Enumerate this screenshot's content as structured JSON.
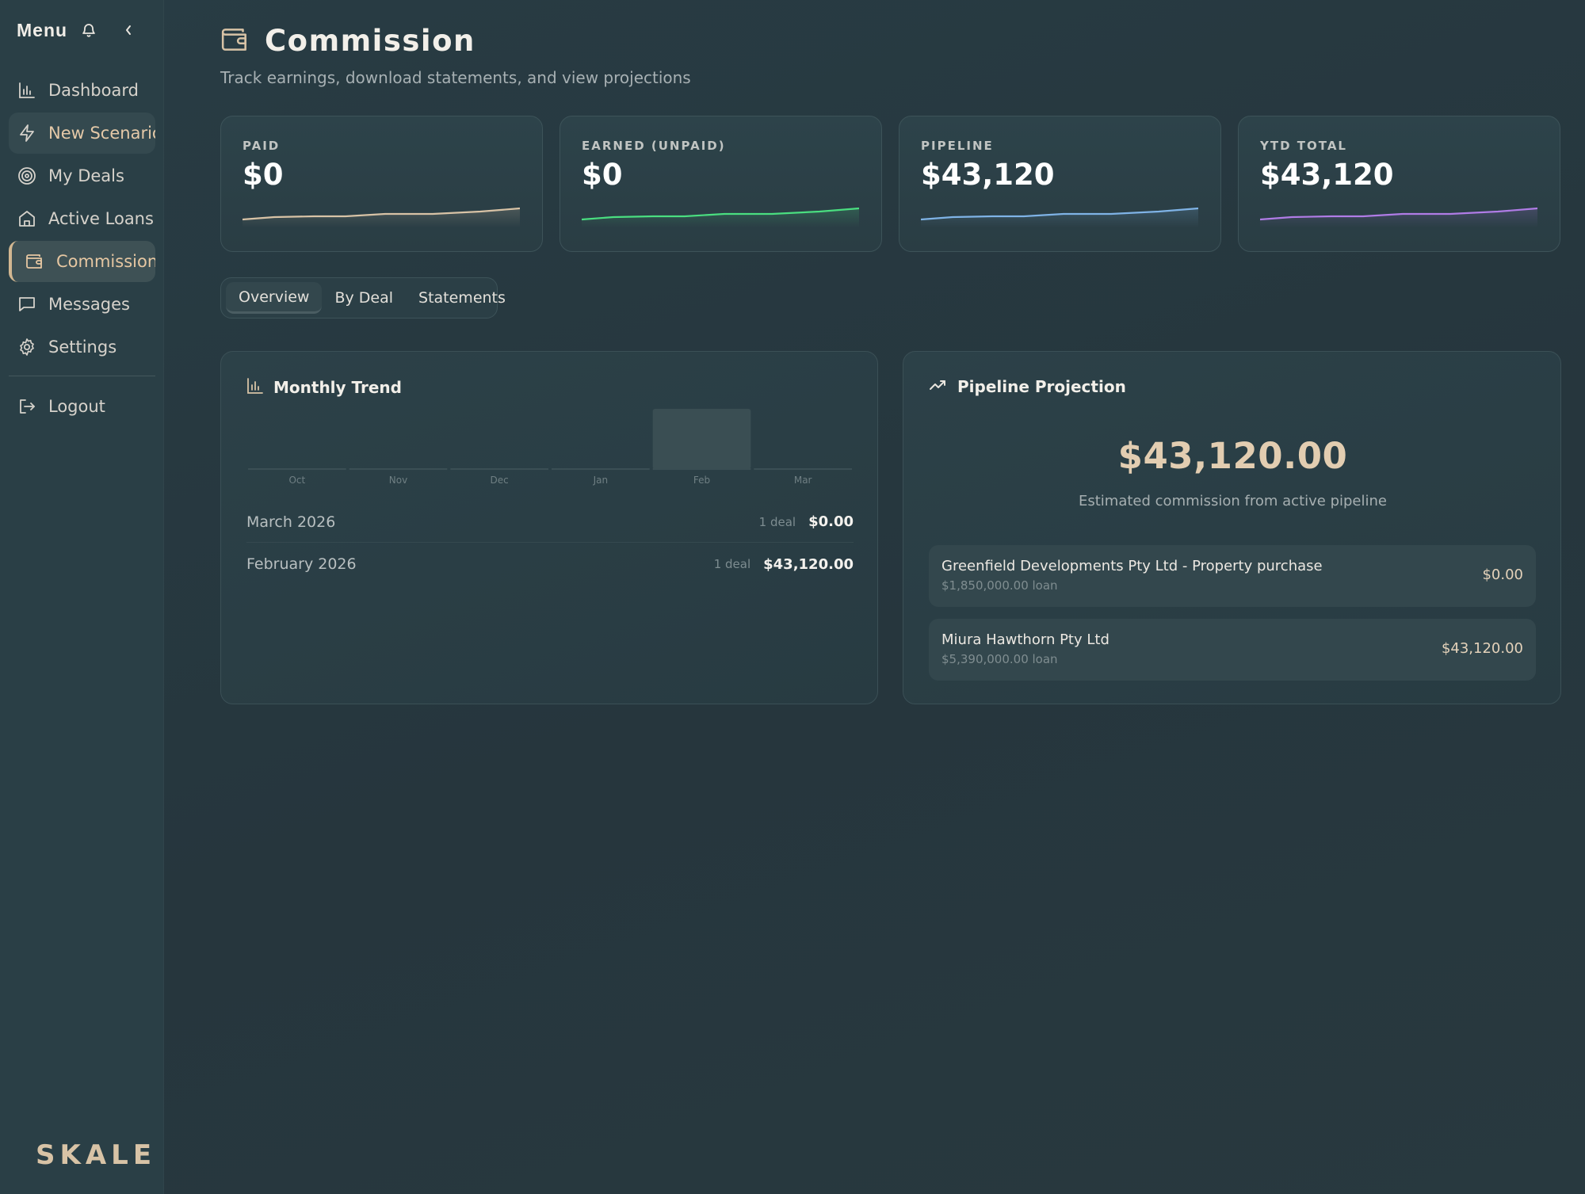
{
  "sidebar": {
    "menu_title": "Menu",
    "items": [
      {
        "label": "Dashboard",
        "icon": "bar-chart-icon"
      },
      {
        "label": "New Scenario",
        "icon": "lightning-icon"
      },
      {
        "label": "My Deals",
        "icon": "target-icon"
      },
      {
        "label": "Active Loans",
        "icon": "home-icon"
      },
      {
        "label": "Commission",
        "icon": "wallet-icon"
      },
      {
        "label": "Messages",
        "icon": "message-icon"
      },
      {
        "label": "Settings",
        "icon": "gear-icon"
      }
    ],
    "logout_label": "Logout",
    "brand": "SKALE"
  },
  "header": {
    "title": "Commission",
    "subtitle": "Track earnings, download statements, and view projections"
  },
  "stats": [
    {
      "label": "PAID",
      "value": "$0",
      "color": "#d8c3a6"
    },
    {
      "label": "EARNED (UNPAID)",
      "value": "$0",
      "color": "#4ade80"
    },
    {
      "label": "PIPELINE",
      "value": "$43,120",
      "color": "#7fb3e6"
    },
    {
      "label": "YTD TOTAL",
      "value": "$43,120",
      "color": "#b07ce6"
    }
  ],
  "tabs": [
    "Overview",
    "By Deal",
    "Statements"
  ],
  "monthly_trend": {
    "title": "Monthly Trend",
    "months": [
      "Oct",
      "Nov",
      "Dec",
      "Jan",
      "Feb",
      "Mar"
    ],
    "rows": [
      {
        "month": "March 2026",
        "count": "1 deal",
        "amount": "$0.00"
      },
      {
        "month": "February 2026",
        "count": "1 deal",
        "amount": "$43,120.00"
      }
    ]
  },
  "chart_data": {
    "type": "bar",
    "categories": [
      "Oct",
      "Nov",
      "Dec",
      "Jan",
      "Feb",
      "Mar"
    ],
    "values": [
      0,
      0,
      0,
      0,
      43120,
      0
    ],
    "title": "",
    "xlabel": "",
    "ylabel": "",
    "grid": false
  },
  "pipeline_projection": {
    "title": "Pipeline Projection",
    "amount": "$43,120.00",
    "caption": "Estimated commission from active pipeline",
    "deals": [
      {
        "name": "Greenfield Developments Pty Ltd - Property purchase",
        "loan": "$1,850,000.00 loan",
        "amount": "$0.00"
      },
      {
        "name": "Miura Hawthorn Pty Ltd",
        "loan": "$5,390,000.00 loan",
        "amount": "$43,120.00"
      }
    ]
  },
  "colors": {
    "accent": "#d8c3a6",
    "background": "#26363d",
    "sidebar": "#2a3f46"
  }
}
